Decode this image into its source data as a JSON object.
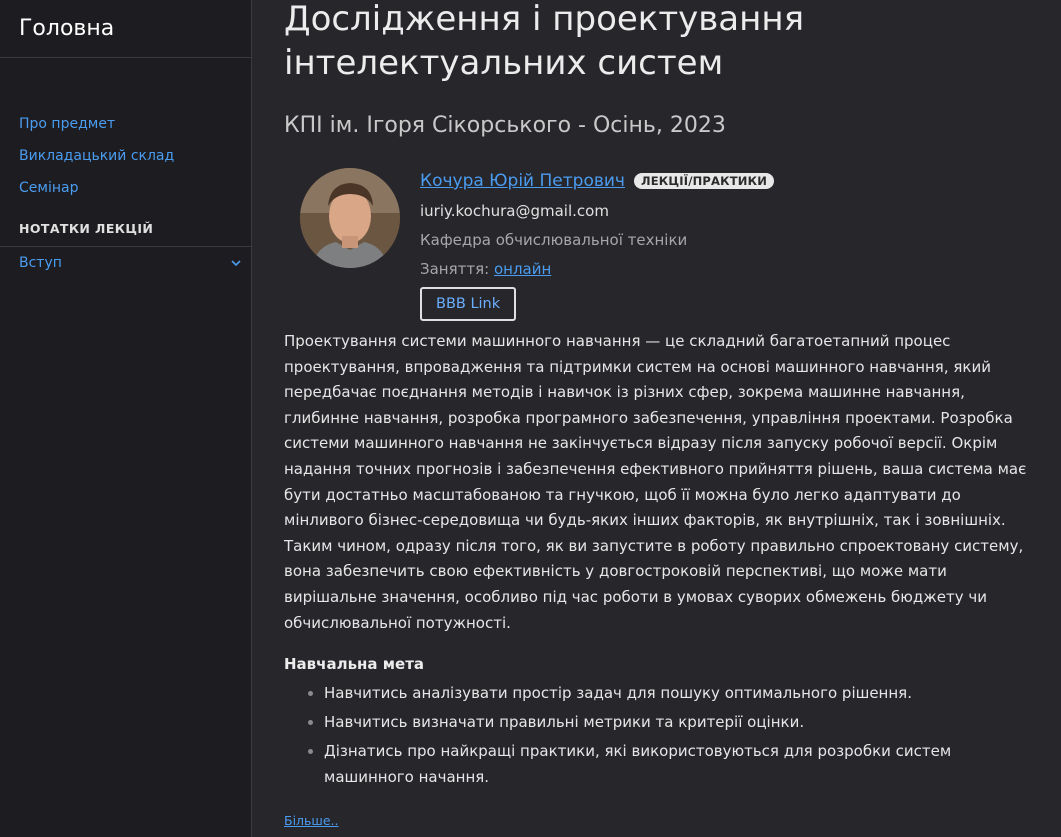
{
  "sidebar": {
    "brand": "Головна",
    "links": [
      "Про предмет",
      "Викладацький склад",
      "Семінар"
    ],
    "section_title": "НОТАТКИ ЛЕКЦІЙ",
    "sub_item": "Вступ"
  },
  "main": {
    "title": "Дослідження і проектування інтелектуальних систем",
    "subtitle": "КПІ ім. Ігоря Сікорського - Осінь, 2023",
    "instructor": {
      "name": "Кочура Юрій Петрович",
      "badge": "ЛЕКЦІЇ/ПРАКТИКИ",
      "email": "iuriy.kochura@gmail.com",
      "department": "Кафедра обчислювальної техніки",
      "classes_label": "Заняття:",
      "classes_link": "онлайн",
      "bbb_button": "BBB Link"
    },
    "description": "Проектування системи машинного навчання — це складний багатоетапний процес проектування, впровадження та підтримки систем на основі машинного навчання, який передбачає поєднання методів і навичок із різних сфер, зокрема машинне навчання, глибинне навчання, розробка програмного забезпечення, управління проектами. Розробка системи машинного навчання не закінчується відразу після запуску робочої версії. Окрім надання точних прогнозів і забезпечення ефективного прийняття рішень, ваша система має бути достатньо масштабованою та гнучкою, щоб її можна було легко адаптувати до мінливого бізнес-середовища чи будь-яких інших факторів, як внутрішніх, так і зовнішніх. Таким чином, одразу після того, як ви запустите в роботу правильно спроектовану систему, вона забезпечить свою ефективність у довгостроковій перспективі, що може мати вирішальне значення, особливо під час роботи в умовах суворих обмежень бюджету чи обчислювальної потужності.",
    "goal_heading": "Навчальна мета",
    "goals": [
      "Навчитись аналізувати простір задач для пошуку оптимального рішення.",
      "Навчитись визначати правильні метрики та критерії оцінки.",
      "Дізнатись про найкращі практики, які використовуються для розробки систем машинного начання."
    ],
    "more_link": "Більше.."
  }
}
